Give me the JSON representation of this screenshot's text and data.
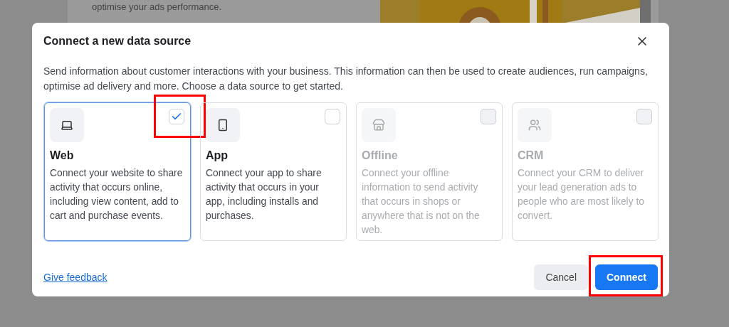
{
  "background": {
    "text": "optimise your ads performance."
  },
  "dialog": {
    "title": "Connect a new data source",
    "description": "Send information about customer interactions with your business. This information can then be used to create audiences, run campaigns, optimise ad delivery and more. Choose a data source to get started.",
    "sources": [
      {
        "title": "Web",
        "description": "Connect your website to share activity that occurs online, including view content, add to cart and purchase events.",
        "selected": true,
        "disabled": false,
        "highlighted": true
      },
      {
        "title": "App",
        "description": "Connect your app to share activity that occurs in your app, including installs and purchases.",
        "selected": false,
        "disabled": false,
        "highlighted": false
      },
      {
        "title": "Offline",
        "description": "Connect your offline information to send activity that occurs in shops or anywhere that is not on the web.",
        "selected": false,
        "disabled": true,
        "highlighted": false
      },
      {
        "title": "CRM",
        "description": "Connect your CRM to deliver your lead generation ads to people who are most likely to convert.",
        "selected": false,
        "disabled": true,
        "highlighted": false
      }
    ],
    "feedback_link": "Give feedback",
    "buttons": [
      {
        "kind": "secondary",
        "label": "Cancel",
        "highlighted": false
      },
      {
        "kind": "primary",
        "label": "Connect",
        "highlighted": true
      }
    ]
  }
}
